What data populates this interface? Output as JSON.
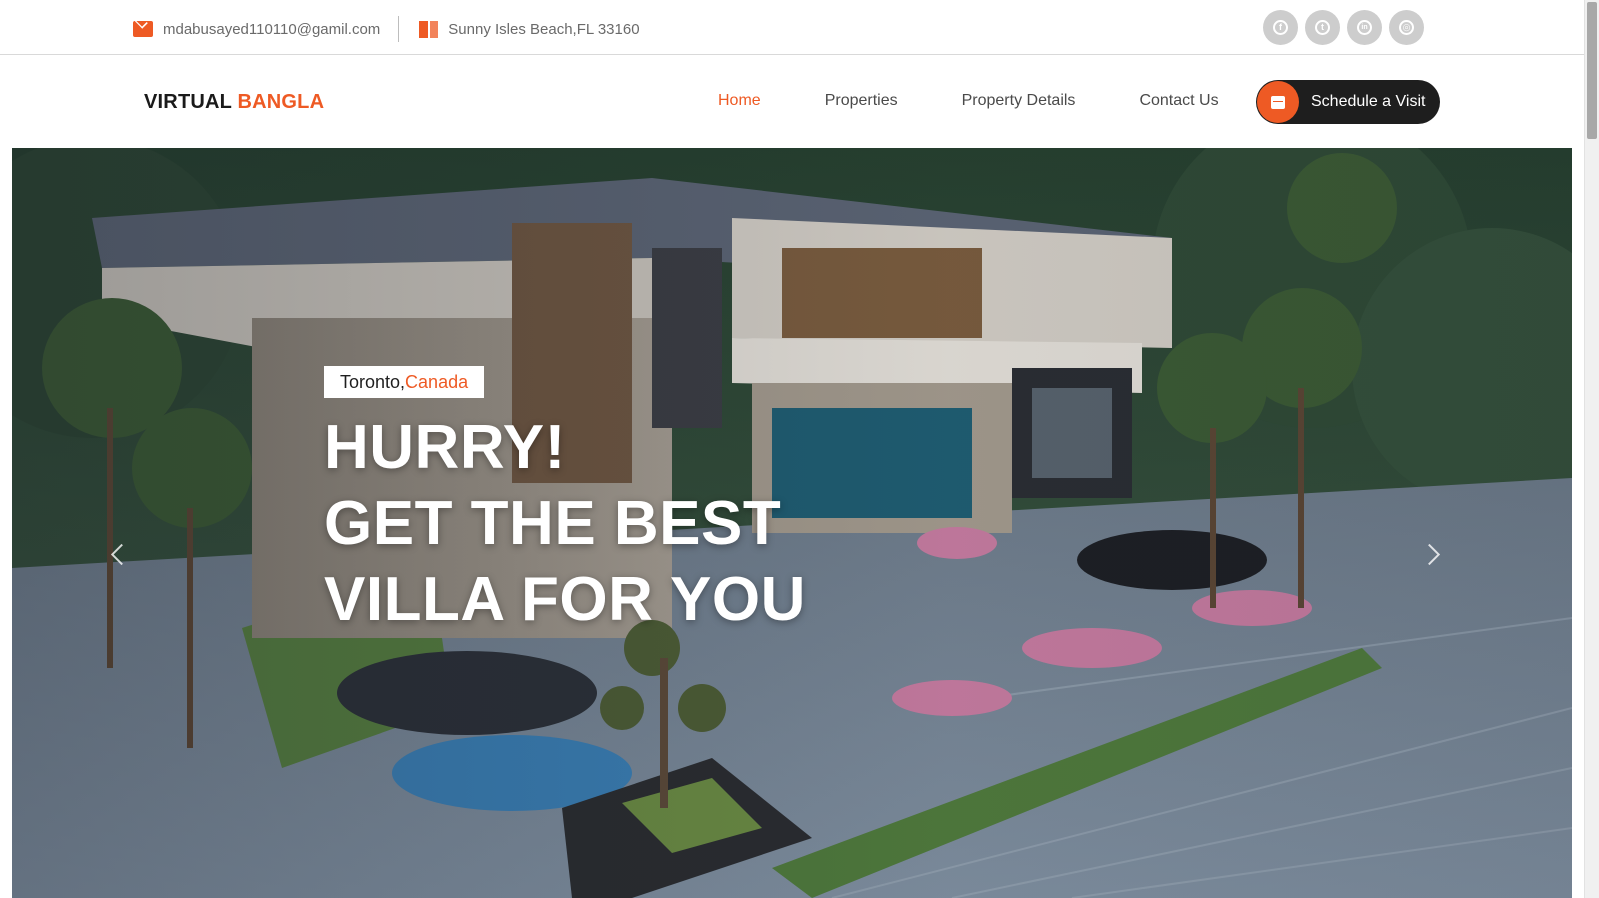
{
  "topbar": {
    "email": "mdabusayed110110@gamil.com",
    "location": "Sunny Isles Beach,FL 33160",
    "email_icon": "envelope-icon",
    "location_icon": "map-icon",
    "socials": [
      {
        "name": "facebook",
        "icon": "facebook-icon",
        "glyph": "f"
      },
      {
        "name": "twitter",
        "icon": "twitter-icon",
        "glyph": "t"
      },
      {
        "name": "linkedin",
        "icon": "linkedin-icon",
        "glyph": "in"
      },
      {
        "name": "instagram",
        "icon": "instagram-icon",
        "glyph": "◎"
      }
    ]
  },
  "brand": {
    "part1": "VIRTUAL",
    "part2": "BANGLA"
  },
  "nav": {
    "items": [
      {
        "label": "Home",
        "active": true
      },
      {
        "label": "Properties",
        "active": false
      },
      {
        "label": "Property Details",
        "active": false
      },
      {
        "label": "Contact Us",
        "active": false
      }
    ],
    "cta_label": "Schedule a Visit",
    "cta_icon": "calendar-icon"
  },
  "hero": {
    "city": "Toronto,",
    "country": "Canada",
    "line1": "HURRY!",
    "line2": "GET THE BEST",
    "line3": "VILLA FOR YOU",
    "prev_icon": "chevron-left-icon",
    "next_icon": "chevron-right-icon"
  },
  "colors": {
    "accent": "#ee5a24",
    "dark": "#1e1e1e",
    "muted": "#6a6a6a"
  }
}
